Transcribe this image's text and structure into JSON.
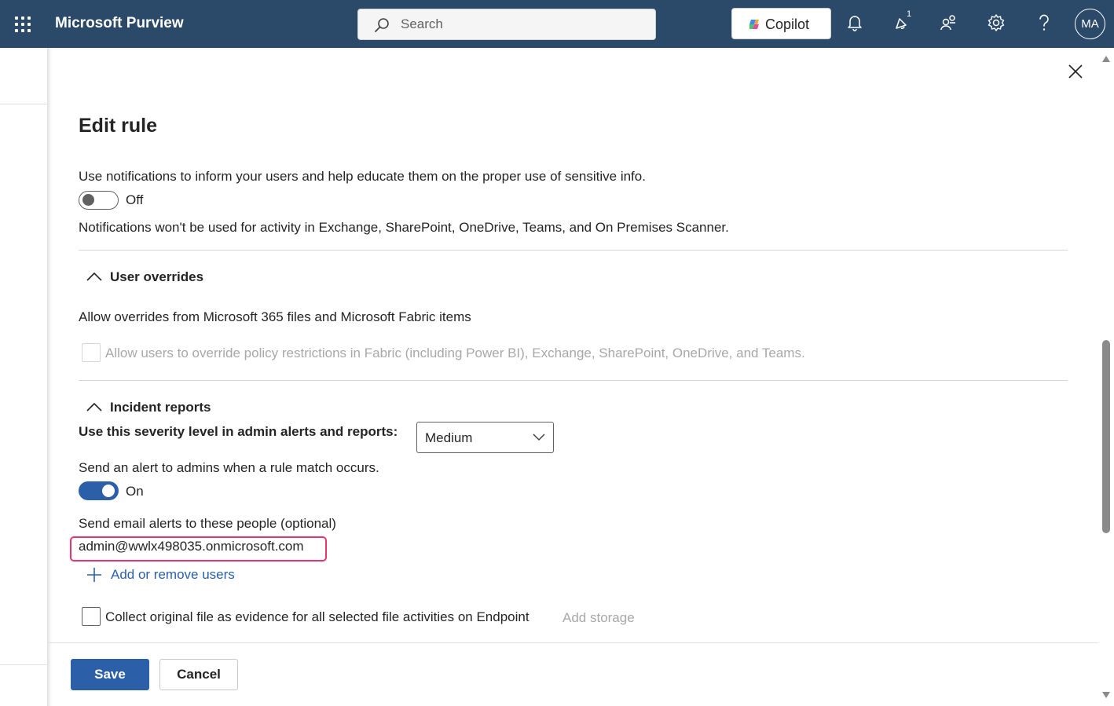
{
  "header": {
    "app_title": "Microsoft Purview",
    "search_placeholder": "Search",
    "copilot_label": "Copilot",
    "notification_badge": "1",
    "avatar_initials": "MA",
    "colors": {
      "bar": "#2b4a6a",
      "accent": "#2b5fa8"
    }
  },
  "panel": {
    "title": "Edit rule",
    "notifications": {
      "description": "Use notifications to inform your users and help educate them on the proper use of sensitive info.",
      "toggle_state": "Off",
      "note": "Notifications won't be used for activity in Exchange, SharePoint, OneDrive, Teams, and On Premises Scanner."
    },
    "user_overrides": {
      "section_title": "User overrides",
      "subheading": "Allow overrides from Microsoft 365 files and Microsoft Fabric items",
      "checkbox_label": "Allow users to override policy restrictions in Fabric (including Power BI), Exchange, SharePoint, OneDrive, and Teams."
    },
    "incident_reports": {
      "section_title": "Incident reports",
      "severity_label": "Use this severity level in admin alerts and reports:",
      "severity_value": "Medium",
      "alert_label": "Send an alert to admins when a rule match occurs.",
      "alert_toggle_state": "On",
      "email_label": "Send email alerts to these people (optional)",
      "email_value": "admin@wwlx498035.onmicrosoft.com",
      "add_users_label": "Add or remove users",
      "evidence_label": "Collect original file as evidence for all selected file activities on Endpoint",
      "add_storage_label": "Add storage"
    },
    "footer": {
      "save_label": "Save",
      "cancel_label": "Cancel"
    }
  }
}
